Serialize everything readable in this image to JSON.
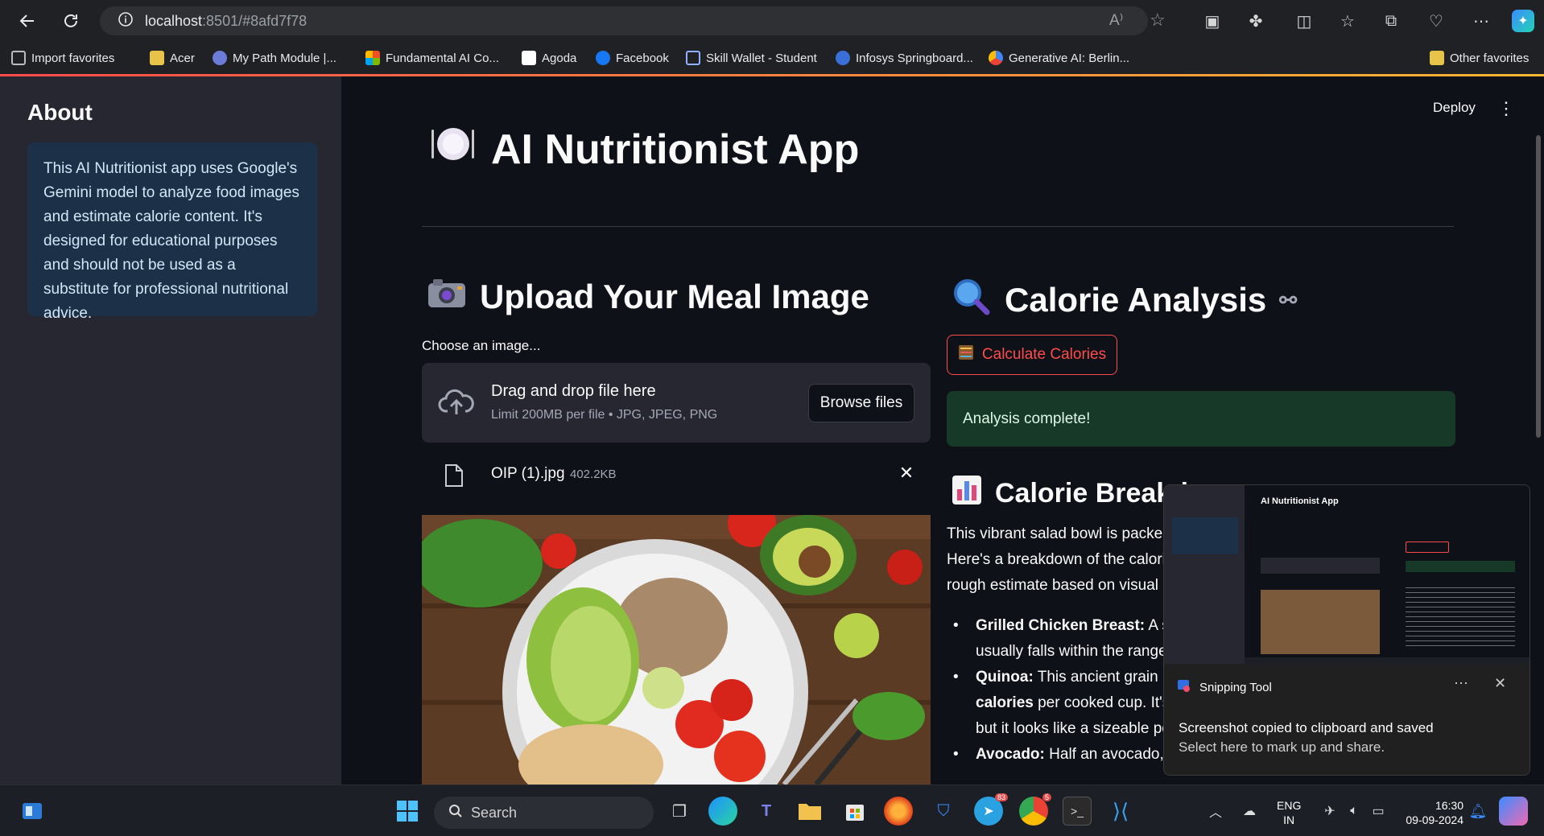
{
  "browser": {
    "url_host": "localhost",
    "url_path": ":8501/#8afd7f78",
    "bookmarks": [
      "Import favorites",
      "Acer",
      "My Path Module |...",
      "Fundamental AI Co...",
      "Agoda",
      "Facebook",
      "Skill Wallet - Student",
      "Infosys Springboard...",
      "Generative AI: Berlin...",
      "Other favorites"
    ]
  },
  "sidebar": {
    "title": "About",
    "text": "This AI Nutritionist app uses Google's Gemini model to analyze food images and estimate calorie content. It's designed for educational purposes and should not be used as a substitute for professional nutritional advice."
  },
  "header": {
    "deploy_label": "Deploy"
  },
  "main": {
    "title": "AI Nutritionist App",
    "upload_heading": "Upload Your Meal Image",
    "choose_label": "Choose an image...",
    "dropzone_title": "Drag and drop file here",
    "dropzone_limit": "Limit 200MB per file • JPG, JPEG, PNG",
    "browse_label": "Browse files",
    "file_name": "OIP (1).jpg",
    "file_size": "402.2KB",
    "analysis_heading": "Calorie Analysis",
    "calc_button": "Calculate Calories",
    "success_message": "Analysis complete!",
    "breakdown_heading": "Calorie Breakd",
    "breakdown_lines": [
      "This vibrant salad bowl is packed",
      "Here's a breakdown of the calori",
      "rough estimate based on visual c"
    ],
    "items": [
      {
        "bold": "Grilled Chicken Breast:",
        "text": " A sta",
        "line2": "usually falls within the range"
      },
      {
        "bold": "Quinoa:",
        "text": " This ancient grain is",
        "line2_bold": "calories",
        "line2": " per cooked cup. It's",
        "line3": "but it looks like a sizeable po"
      },
      {
        "bold": "Avocado:",
        "text": " Half an avocado, li"
      }
    ]
  },
  "snipping": {
    "app_name": "Snipping Tool",
    "line1": "Screenshot copied to clipboard and saved",
    "line2": "Select here to mark up and share.",
    "preview_title": "AI Nutritionist App"
  },
  "taskbar": {
    "search_placeholder": "Search",
    "lang1": "ENG",
    "lang2": "IN",
    "time": "16:30",
    "date": "09-09-2024",
    "telegram_badge": "83",
    "chrome_badge": "5"
  }
}
